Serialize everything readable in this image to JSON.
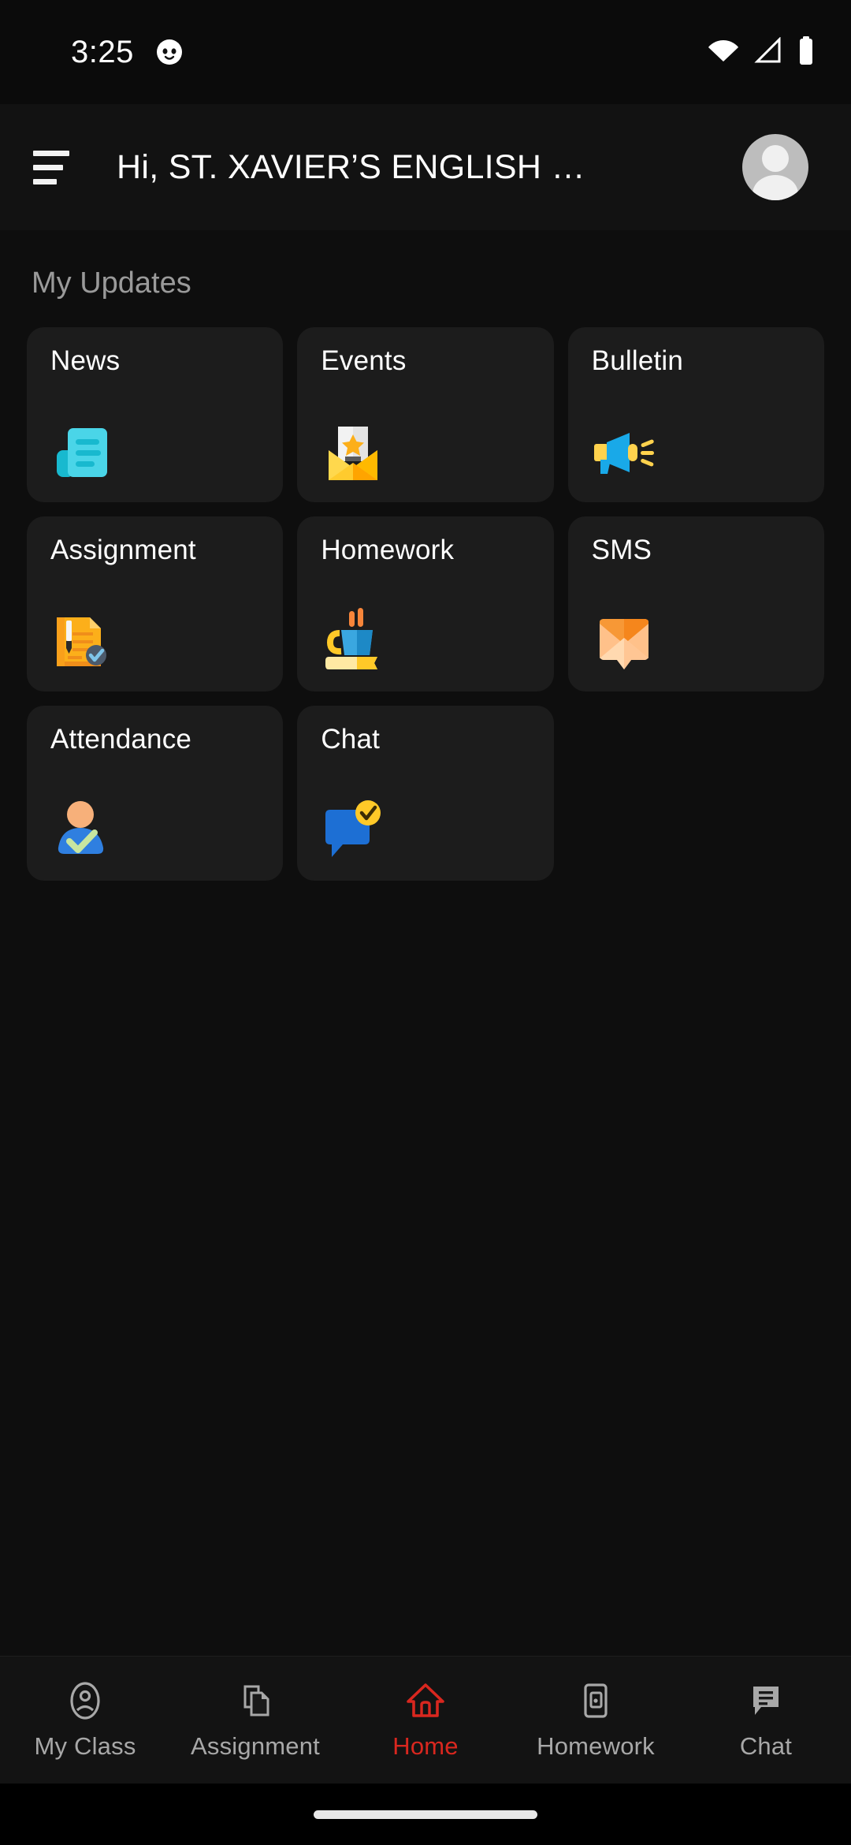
{
  "status_bar": {
    "time": "3:25",
    "notification_icon": "cat-face-icon",
    "icons": [
      "wifi-icon",
      "cellular-signal-icon",
      "battery-icon"
    ]
  },
  "app_bar": {
    "menu_icon": "hamburger-menu-icon",
    "title": "Hi, ST. XAVIER’S ENGLISH …",
    "avatar_icon": "user-avatar-icon"
  },
  "main": {
    "section_title": "My Updates",
    "cards": [
      {
        "label": "News",
        "icon": "newspaper-icon",
        "color": "#4ad5e8"
      },
      {
        "label": "Events",
        "icon": "envelope-star-icon",
        "color": "#ffc928"
      },
      {
        "label": "Bulletin",
        "icon": "megaphone-icon",
        "color": "#19a9e8"
      },
      {
        "label": "Assignment",
        "icon": "document-pen-check-icon",
        "color": "#fcaf1a"
      },
      {
        "label": "Homework",
        "icon": "coffee-book-icon",
        "color": "#1d89c6"
      },
      {
        "label": "SMS",
        "icon": "mail-bubble-icon",
        "color": "#f79836"
      },
      {
        "label": "Attendance",
        "icon": "person-check-icon",
        "color": "#2f7fe0"
      },
      {
        "label": "Chat",
        "icon": "chat-bubble-check-icon",
        "color": "#1d6fd4"
      }
    ]
  },
  "bottom_nav": {
    "active": "Home",
    "active_color": "#d9271f",
    "inactive_color": "#a8a8a8",
    "items": [
      {
        "label": "My Class",
        "icon": "person-circle-icon"
      },
      {
        "label": "Assignment",
        "icon": "copy-document-icon"
      },
      {
        "label": "Home",
        "icon": "home-icon"
      },
      {
        "label": "Homework",
        "icon": "device-book-icon"
      },
      {
        "label": "Chat",
        "icon": "chat-lines-icon"
      }
    ]
  },
  "gesture_bar": {
    "name": "home-gesture-bar"
  }
}
